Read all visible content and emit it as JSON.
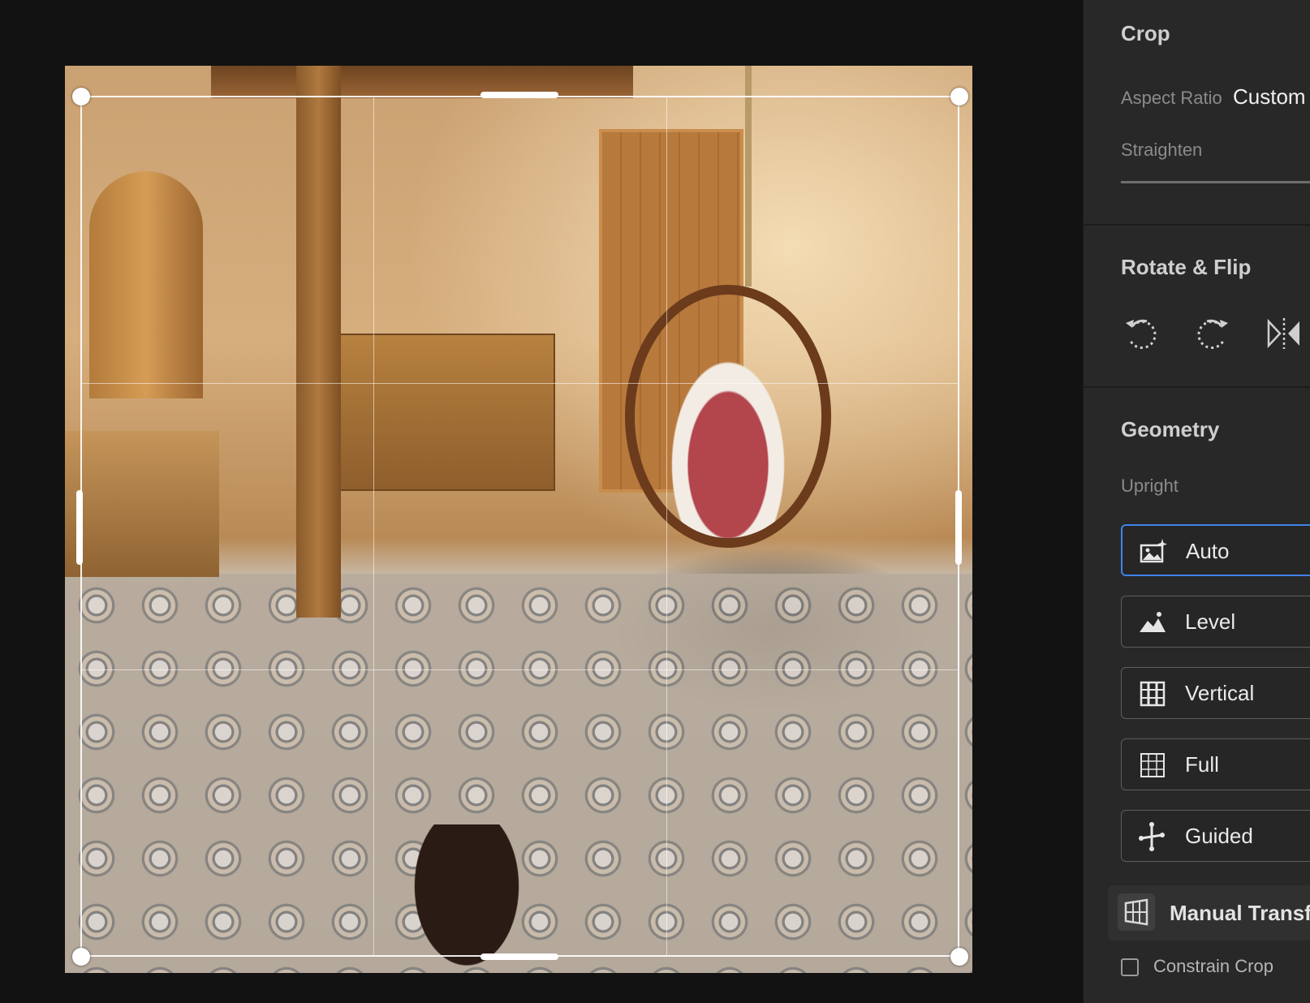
{
  "panel": {
    "crop": {
      "title": "Crop",
      "aspect_ratio_label": "Aspect Ratio",
      "aspect_ratio_value": "Custom",
      "straighten_label": "Straighten"
    },
    "rotate_flip": {
      "title": "Rotate & Flip",
      "icons": [
        "rotate-left-icon",
        "rotate-right-icon",
        "flip-horizontal-icon"
      ]
    },
    "geometry": {
      "title": "Geometry",
      "upright_label": "Upright",
      "buttons": [
        {
          "label": "Auto",
          "icon": "auto-upright-icon",
          "selected": true
        },
        {
          "label": "Level",
          "icon": "level-icon",
          "selected": false
        },
        {
          "label": "Vertical",
          "icon": "vertical-grid-icon",
          "selected": false
        },
        {
          "label": "Full",
          "icon": "full-grid-icon",
          "selected": false
        },
        {
          "label": "Guided",
          "icon": "guided-icon",
          "selected": false
        }
      ],
      "manual_transform_label": "Manual Transfor",
      "constrain_crop_label": "Constrain Crop",
      "constrain_crop_checked": false
    }
  },
  "colors": {
    "panel_bg": "#282828",
    "canvas_bg": "#121212",
    "accent_selected": "#3f82e8"
  }
}
